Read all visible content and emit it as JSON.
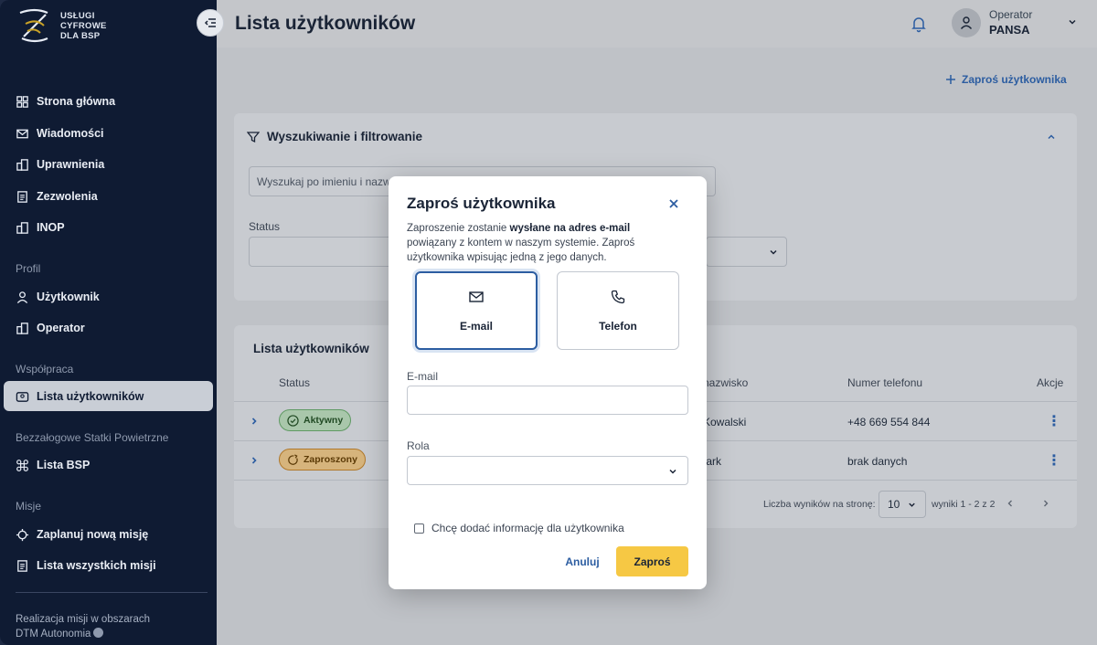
{
  "brand": {
    "line1": "USŁUGI",
    "line2": "CYFROWE",
    "line3": "DLA BSP"
  },
  "sidebar": {
    "items": [
      {
        "label": "Strona główna"
      },
      {
        "label": "Wiadomości"
      },
      {
        "label": "Uprawnienia"
      },
      {
        "label": "Zezwolenia"
      },
      {
        "label": "INOP"
      }
    ],
    "section_profile": "Profil",
    "profile_items": [
      {
        "label": "Użytkownik"
      },
      {
        "label": "Operator"
      }
    ],
    "section_coop": "Współpraca",
    "coop_items": [
      {
        "label": "Lista użytkowników"
      }
    ],
    "section_uav": "Bezzałogowe Statki Powietrzne",
    "uav_items": [
      {
        "label": "Lista BSP"
      }
    ],
    "section_missions": "Misje",
    "mission_items": [
      {
        "label": "Zaplanuj nową misję"
      },
      {
        "label": "Lista wszystkich misji"
      }
    ],
    "footer_line1": "Realizacja misji w obszarach",
    "footer_line2": "DTM Autonomia"
  },
  "header": {
    "title": "Lista użytkowników",
    "operator_role": "Operator",
    "operator_name": "PANSA"
  },
  "actions": {
    "invite_link": "Zaproś użytkownika"
  },
  "filters": {
    "title": "Wyszukiwanie i filtrowanie",
    "search_placeholder": "Wyszukaj po imieniu i nazwisku",
    "status_label": "Status"
  },
  "table": {
    "title": "Lista użytkowników",
    "columns": {
      "status": "Status",
      "surname": "nazwisko",
      "phone": "Numer telefonu",
      "actions": "Akcje"
    },
    "rows": [
      {
        "status": "Aktywny",
        "surname": "Kowalski",
        "phone": "+48 669 554 844"
      },
      {
        "status": "Zaproszony",
        "surname": "tark",
        "phone": "brak danych"
      }
    ],
    "pagination": {
      "per_page_label": "Liczba wyników na stronę:",
      "per_page": "10",
      "range": "wyniki 1 - 2 z 2"
    }
  },
  "modal": {
    "title": "Zaproś użytkownika",
    "desc_start": "Zaproszenie zostanie ",
    "desc_bold": "wysłane na adres e-mail",
    "desc_end": " powiązany z kontem w naszym systemie. Zaproś użytkownika wpisując jedną z jego danych.",
    "option_email": "E-mail",
    "option_phone": "Telefon",
    "email_label": "E-mail",
    "role_label": "Rola",
    "checkbox_label": "Chcę dodać informację dla użytkownika",
    "cancel": "Anuluj",
    "submit": "Zaproś"
  },
  "colors": {
    "sidebar_bg": "#0f1b33",
    "accent_blue": "#2c5da1",
    "submit_yellow": "#f6c844"
  }
}
